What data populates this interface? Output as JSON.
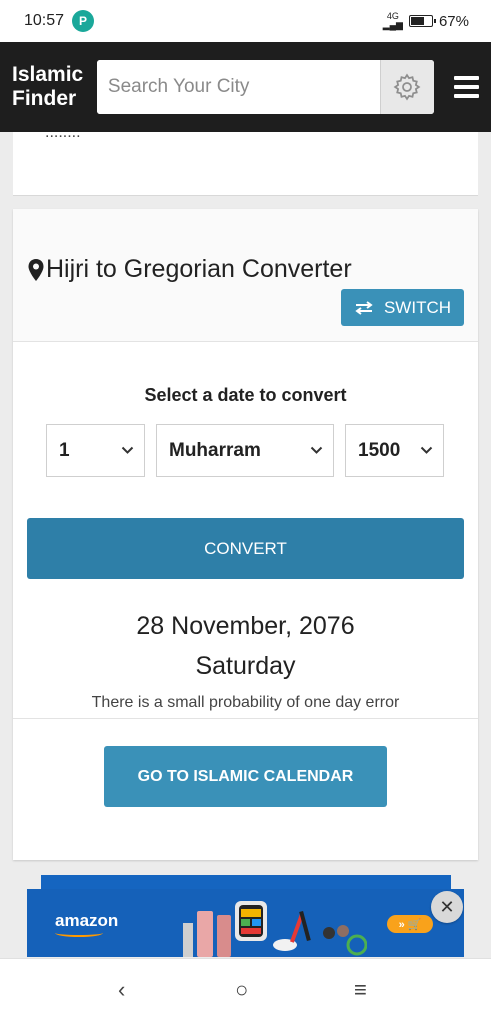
{
  "status_bar": {
    "time": "10:57",
    "notif_icon": "P",
    "network": "4G",
    "battery": "67%",
    "battery_level": 0.67
  },
  "header": {
    "brand_line1": "Islamic",
    "brand_line2": "Finder",
    "search_placeholder": "Search Your City"
  },
  "top_card": {
    "cut_text": "........"
  },
  "converter": {
    "title": "Hijri to Gregorian Converter",
    "switch_label": "SWITCH",
    "select_label": "Select a date to convert",
    "day": "1",
    "month": "Muharram",
    "year": "1500",
    "convert_label": "CONVERT",
    "result_date": "28 November, 2076",
    "result_day": "Saturday",
    "note": "There is a small probability of one day error",
    "calendar_label": "GO TO ISLAMIC CALENDAR"
  },
  "ad": {
    "brand": "amazon",
    "cta": "» 🛒",
    "close": "✕"
  },
  "nav": {
    "back": "‹",
    "home": "○",
    "recents": "≡"
  },
  "colors": {
    "header_bg": "#1e1e1e",
    "button_primary": "#3a91b8",
    "convert_button": "#2e7fa8",
    "ad_bg": "#1561b9"
  }
}
